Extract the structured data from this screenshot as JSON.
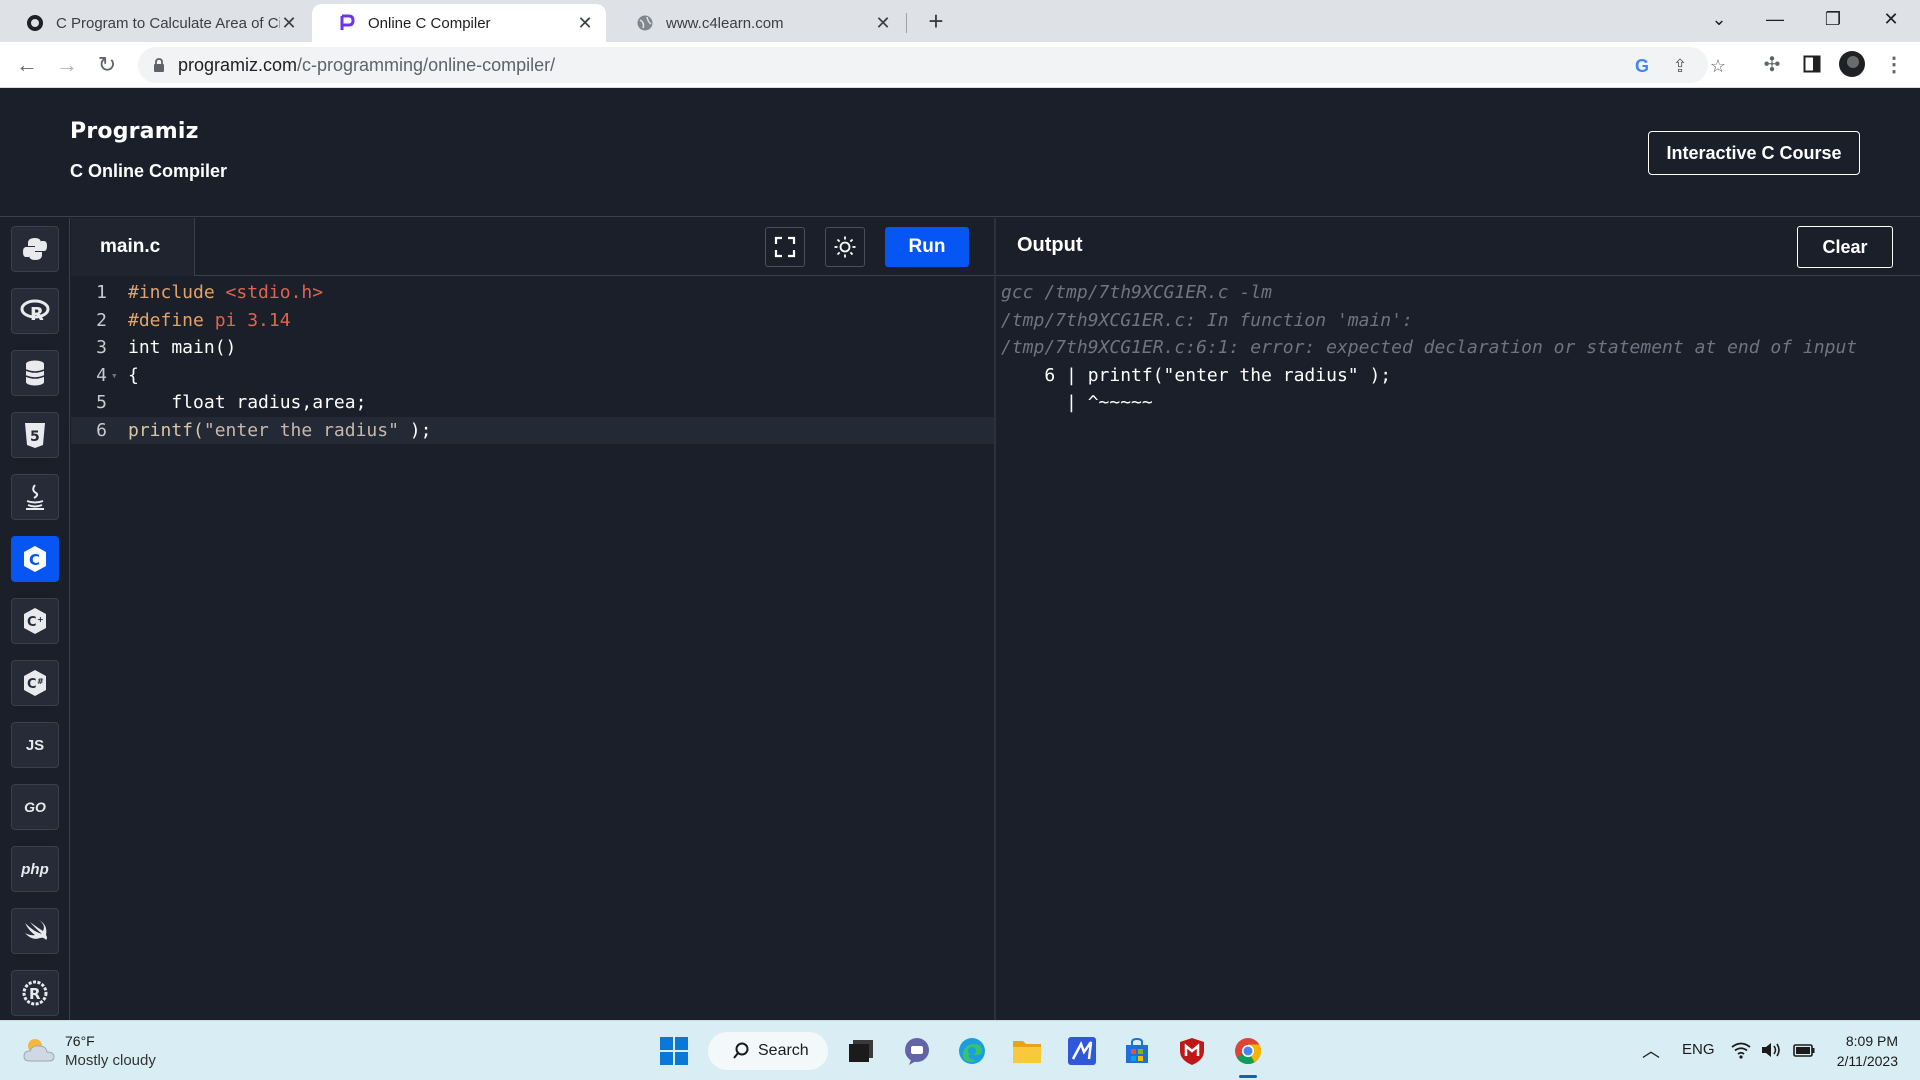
{
  "browser": {
    "tabs": [
      {
        "title": "C Program to Calculate Area of Circle",
        "active": false
      },
      {
        "title": "Online C Compiler",
        "active": true
      },
      {
        "title": "www.c4learn.com",
        "active": false
      }
    ],
    "url_host": "programiz.com",
    "url_path": "/c-programming/online-compiler/"
  },
  "site": {
    "logo": "Programiz",
    "subtitle": "C Online Compiler",
    "course_button": "Interactive C Course"
  },
  "sidebar": {
    "languages": [
      {
        "name": "python-icon",
        "label": ""
      },
      {
        "name": "r-icon",
        "label": ""
      },
      {
        "name": "sql-icon",
        "label": ""
      },
      {
        "name": "html-icon",
        "label": ""
      },
      {
        "name": "java-icon",
        "label": ""
      },
      {
        "name": "c-icon",
        "label": "",
        "active": true
      },
      {
        "name": "cpp-icon",
        "label": ""
      },
      {
        "name": "csharp-icon",
        "label": ""
      },
      {
        "name": "javascript-icon",
        "label": "JS"
      },
      {
        "name": "go-icon",
        "label": "GO"
      },
      {
        "name": "php-icon",
        "label": "php"
      },
      {
        "name": "swift-icon",
        "label": ""
      },
      {
        "name": "rust-icon",
        "label": ""
      }
    ]
  },
  "editor": {
    "filename": "main.c",
    "run_label": "Run",
    "lines": [
      {
        "n": "1",
        "parts": [
          [
            "#include ",
            "c-pre"
          ],
          [
            "<stdio.h>",
            "c-str"
          ]
        ]
      },
      {
        "n": "2",
        "parts": [
          [
            "#define ",
            "c-pre"
          ],
          [
            "pi 3.14",
            "c-str"
          ]
        ]
      },
      {
        "n": "3",
        "parts": [
          [
            "int main()",
            "c-kw"
          ]
        ]
      },
      {
        "n": "4",
        "fold": true,
        "parts": [
          [
            "{",
            "c-kw"
          ]
        ]
      },
      {
        "n": "5",
        "parts": [
          [
            "    float radius,area;",
            "c-kw"
          ]
        ]
      },
      {
        "n": "6",
        "current": true,
        "parts": [
          [
            "printf(",
            "c-fn"
          ],
          [
            "\"enter the radius\"",
            "c-strb"
          ],
          [
            " );",
            "c-kw"
          ]
        ]
      }
    ]
  },
  "output": {
    "title": "Output",
    "clear_label": "Clear",
    "lines": [
      {
        "text": "gcc /tmp/7th9XCG1ER.c -lm",
        "style": "dim"
      },
      {
        "text": "/tmp/7th9XCG1ER.c: In function 'main':",
        "style": "dim"
      },
      {
        "text": "/tmp/7th9XCG1ER.c:6:1: error: expected declaration or statement at end of input",
        "style": "dim"
      },
      {
        "text": "    6 | printf(\"enter the radius\" );",
        "style": "bright"
      },
      {
        "text": "      | ^~~~~~",
        "style": "bright"
      }
    ]
  },
  "taskbar": {
    "temperature": "76°F",
    "weather": "Mostly cloudy",
    "search_label": "Search",
    "language": "ENG",
    "time": "8:09 PM",
    "date": "2/11/2023"
  },
  "colors": {
    "accent": "#0556f3",
    "background": "#1b1f2a",
    "taskbar": "#d9eef4"
  }
}
